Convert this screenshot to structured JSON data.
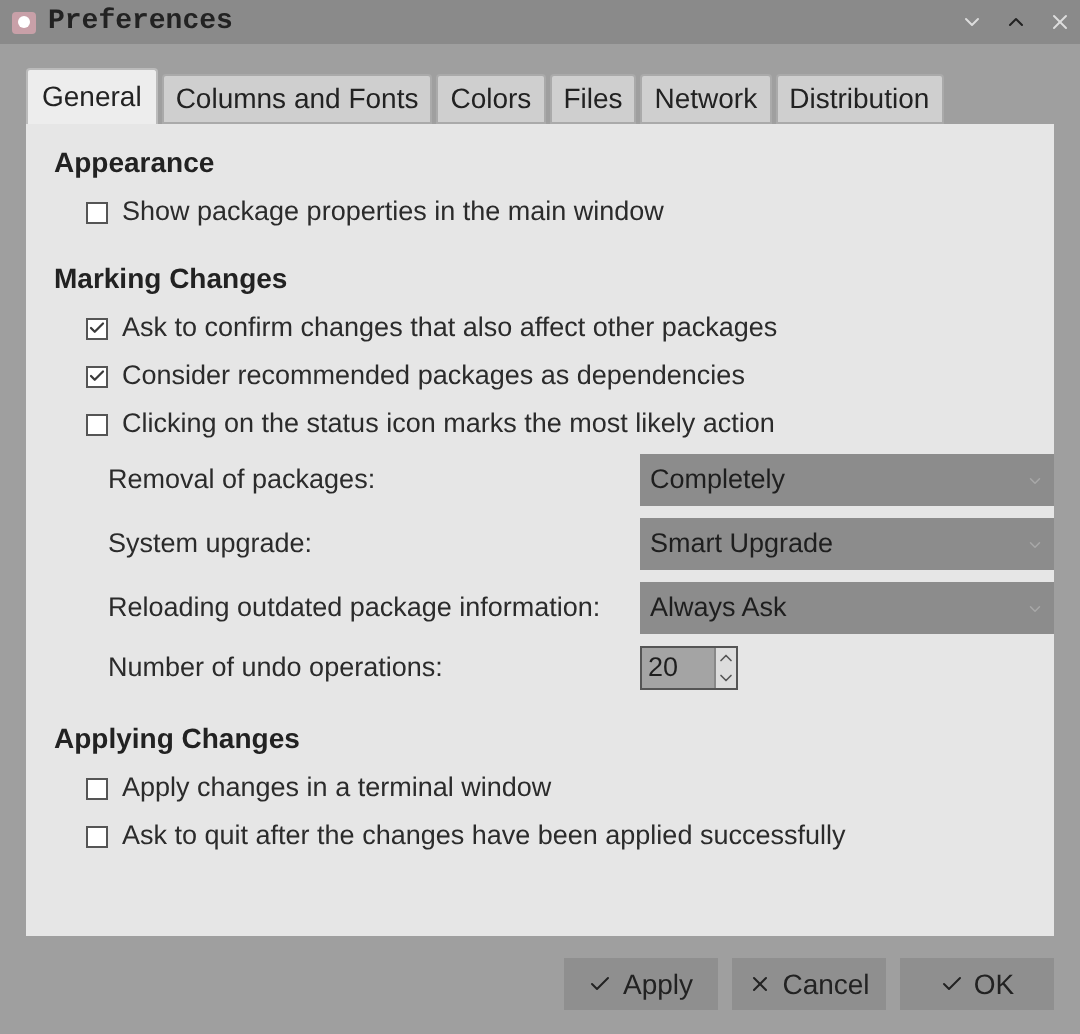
{
  "window": {
    "title": "Preferences"
  },
  "tabs": [
    {
      "label": "General",
      "selected": true
    },
    {
      "label": "Columns and Fonts",
      "selected": false
    },
    {
      "label": "Colors",
      "selected": false
    },
    {
      "label": "Files",
      "selected": false
    },
    {
      "label": "Network",
      "selected": false
    },
    {
      "label": "Distribution",
      "selected": false
    }
  ],
  "sections": [
    {
      "heading": "Appearance",
      "items": [
        {
          "kind": "checkbox",
          "label": "Show package properties in the main window",
          "checked": false
        }
      ]
    },
    {
      "heading": "Marking Changes",
      "items": [
        {
          "kind": "checkbox",
          "label": "Ask to confirm changes that also affect other packages",
          "checked": true
        },
        {
          "kind": "checkbox",
          "label": "Consider recommended packages as dependencies",
          "checked": true
        },
        {
          "kind": "checkbox",
          "label": "Clicking on the status icon marks the most likely action",
          "checked": false
        },
        {
          "kind": "combo",
          "label": "Removal of packages:",
          "value": "Completely"
        },
        {
          "kind": "combo",
          "label": "System upgrade:",
          "value": "Smart Upgrade"
        },
        {
          "kind": "combo",
          "label": "Reloading outdated package information:",
          "value": "Always Ask"
        },
        {
          "kind": "spin",
          "label": "Number of undo operations:",
          "value": "20"
        }
      ]
    },
    {
      "heading": "Applying Changes",
      "items": [
        {
          "kind": "checkbox",
          "label": "Apply changes in a terminal window",
          "checked": false
        },
        {
          "kind": "checkbox",
          "label": "Ask to quit after the changes have been applied successfully",
          "checked": false
        }
      ]
    }
  ],
  "buttons": [
    {
      "label": "Apply",
      "kind": "check"
    },
    {
      "label": "Cancel",
      "kind": "cancel"
    },
    {
      "label": "OK",
      "kind": "check"
    }
  ]
}
